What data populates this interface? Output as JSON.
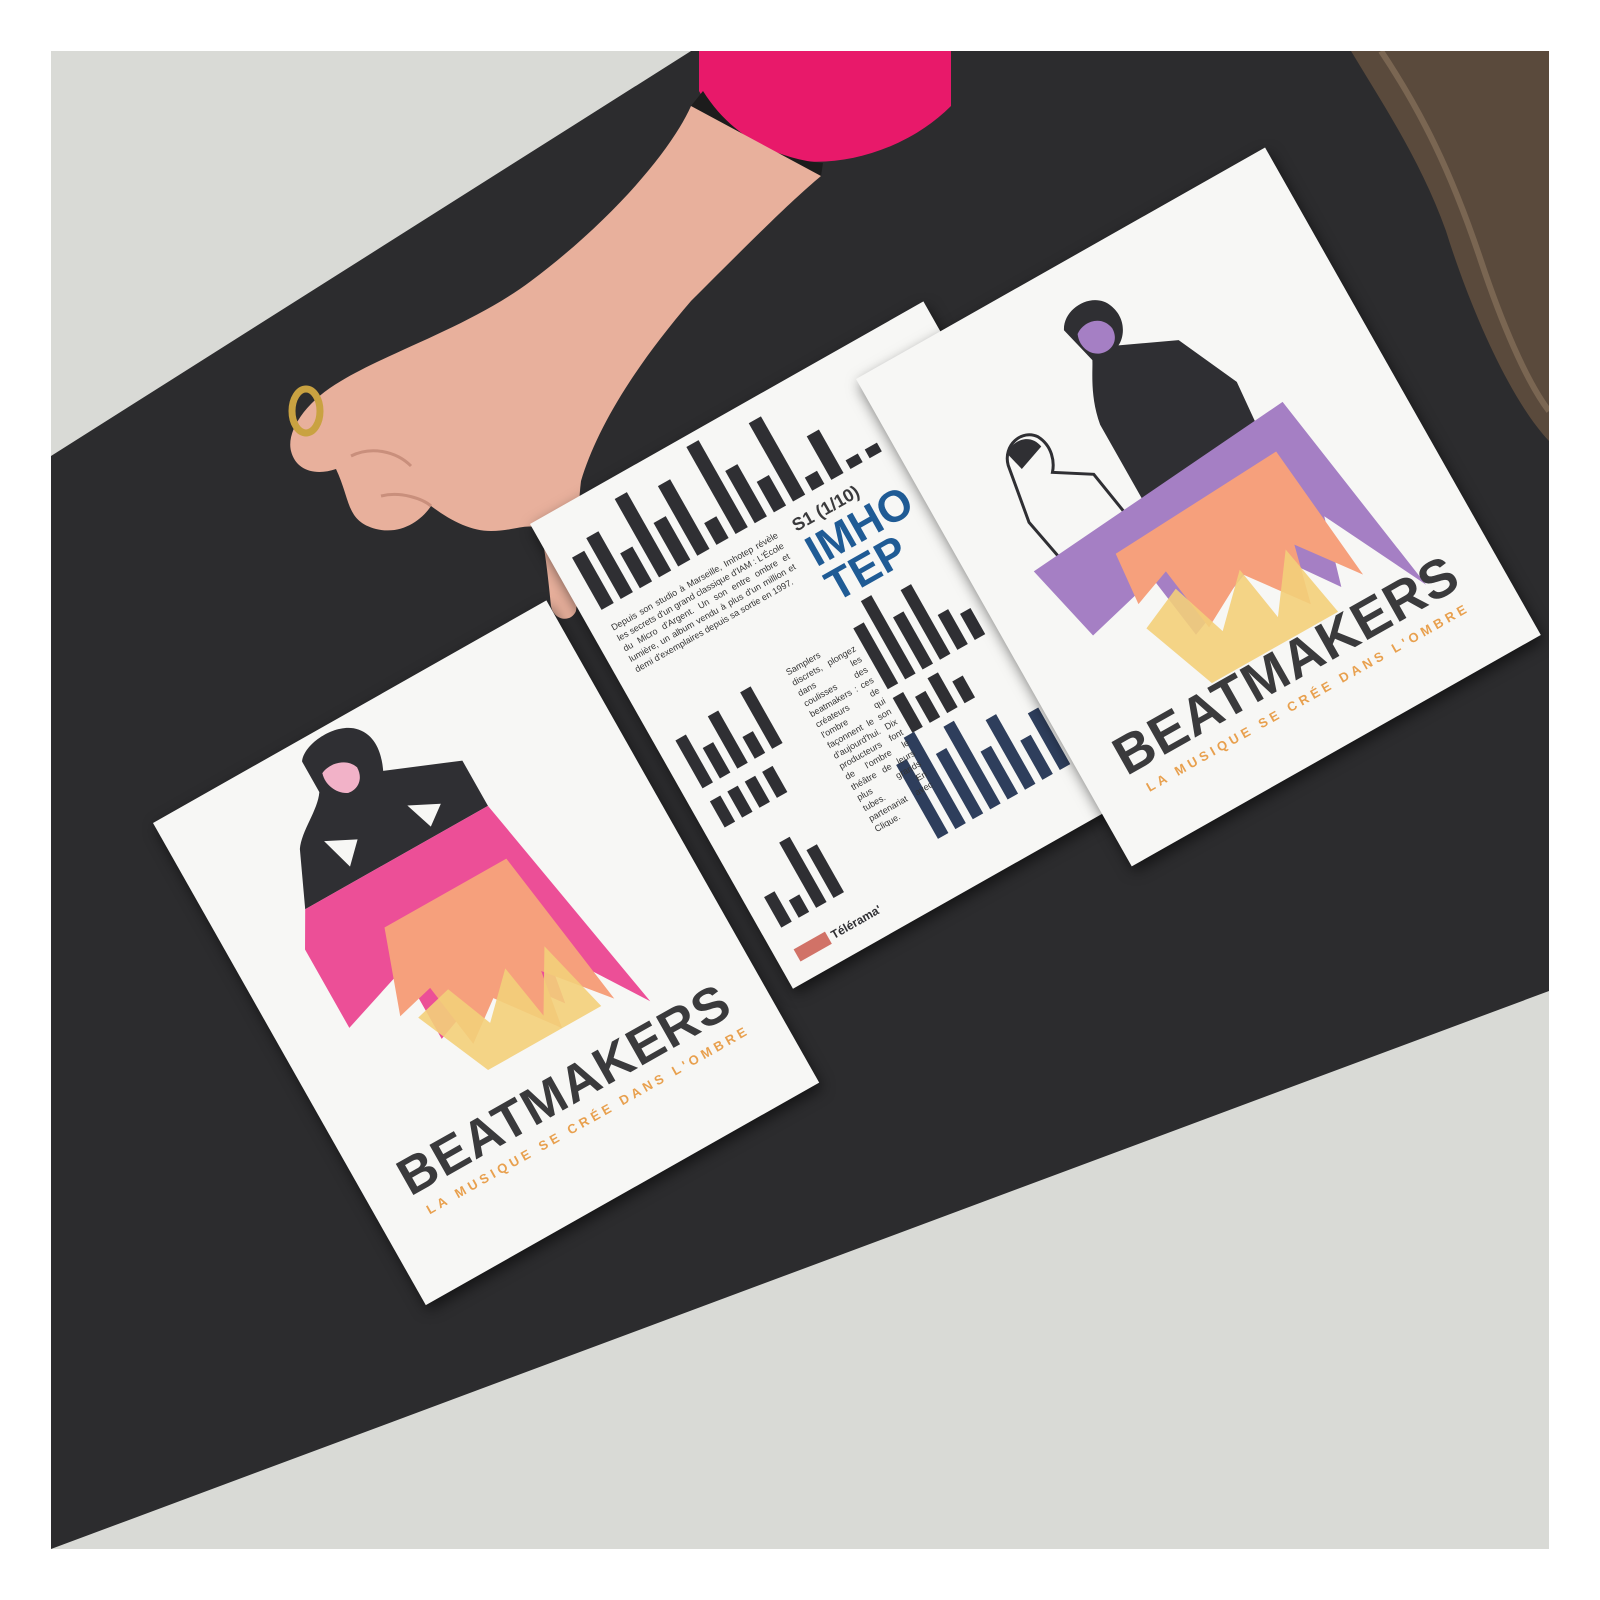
{
  "photo": {
    "colors": {
      "floor": "#d9dad6",
      "table": "#2c2c2e",
      "sleeve": "#e8196a",
      "skin": "#e8b09c",
      "hair": "#5a4a3c",
      "card": "#f7f7f5",
      "pink": "#ec4f97",
      "salmon": "#f6a07c",
      "yellow": "#f3cf7a",
      "purple": "#a57fc4",
      "ink": "#2f2f33",
      "blue": "#1f5b95",
      "orange": "#e8a04e"
    }
  },
  "poster_left": {
    "title": "BEATMAKERS",
    "subtitle": "LA MUSIQUE SE CRÉE DANS L'OMBRE"
  },
  "poster_middle": {
    "issue": "S1 (1/10)",
    "headline_line1": "IMHO",
    "headline_line2": "TEP",
    "body_left": "Depuis son studio à Marseille, Imhotep révèle les secrets d'un grand classique d'IAM : L'École du Micro d'Argent. Un son entre ombre et lumière, un album vendu à plus d'un million et demi d'exemplaires depuis sa sortie en 1997.",
    "body_right": "Samplers discrets, plongez dans les coulisses des beatmakers : ces créateurs de l'ombre qui façonnent le son d'aujourd'hui. Dix producteurs font de l'ombre le théâtre de leurs plus grands tubes. En partenariat avec Clique.",
    "logo_text": "Télérama'"
  },
  "poster_right": {
    "title": "BEATMAKERS",
    "subtitle": "LA MUSIQUE SE CRÉE DANS L'OMBRE"
  }
}
